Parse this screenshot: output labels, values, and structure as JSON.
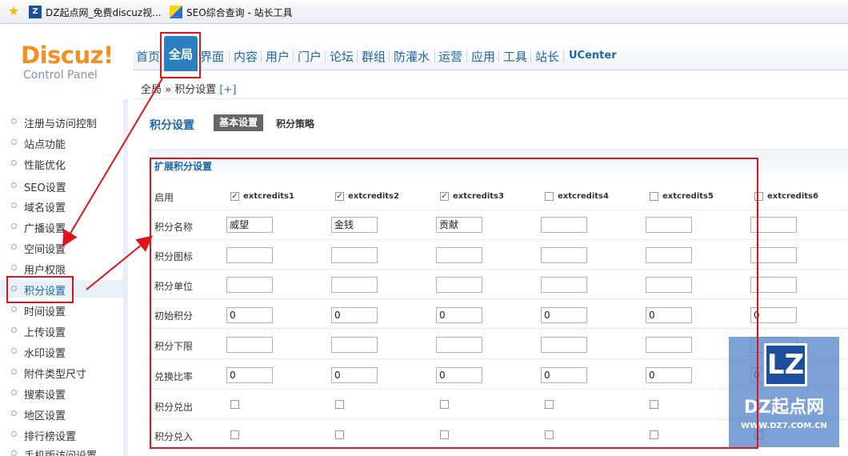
{
  "bookmarks": [
    {
      "label": "DZ起点网_免费discuz视..."
    },
    {
      "label": "SEO综合查询 - 站长工具"
    }
  ],
  "logo": {
    "main": "Discuz!",
    "sub": "Control Panel"
  },
  "nav": {
    "active": "全局",
    "items": [
      "首页",
      "界面",
      "内容",
      "用户",
      "门户",
      "论坛",
      "群组",
      "防灌水",
      "运营",
      "应用",
      "工具",
      "站长",
      "UCenter"
    ]
  },
  "breadcrumb": {
    "path": "全局 » 积分设置",
    "plus": "[+]"
  },
  "sidebar": {
    "items": [
      "注册与访问控制",
      "站点功能",
      "性能优化",
      "SEO设置",
      "域名设置",
      "广播设置",
      "空间设置",
      "用户权限",
      "积分设置",
      "时间设置",
      "上传设置",
      "水印设置",
      "附件类型尺寸",
      "搜索设置",
      "地区设置",
      "排行榜设置",
      "手机版访问设置"
    ],
    "active": "积分设置"
  },
  "page": {
    "title": "积分设置",
    "tab_basic": "基本设置",
    "tab_policy": "积分策略"
  },
  "section": {
    "title": "扩展积分设置"
  },
  "table": {
    "columns": [
      {
        "name": "extcredits1",
        "enabled": true,
        "title": "威望",
        "initial": "0",
        "ratio": "0"
      },
      {
        "name": "extcredits2",
        "enabled": true,
        "title": "金钱",
        "initial": "0",
        "ratio": "0"
      },
      {
        "name": "extcredits3",
        "enabled": true,
        "title": "贡献",
        "initial": "0",
        "ratio": "0"
      },
      {
        "name": "extcredits4",
        "enabled": false,
        "title": "",
        "initial": "0",
        "ratio": "0"
      },
      {
        "name": "extcredits5",
        "enabled": false,
        "title": "",
        "initial": "0",
        "ratio": "0"
      },
      {
        "name": "extcredits6",
        "enabled": false,
        "title": "",
        "initial": "0",
        "ratio": "0"
      }
    ],
    "row_labels": {
      "enable": "启用",
      "name": "积分名称",
      "icon": "积分图标",
      "unit": "积分单位",
      "initial": "初始积分",
      "lower": "积分下限",
      "ratio": "兑换比率",
      "out": "积分兑出",
      "in": "积分兑入"
    }
  },
  "watermark": {
    "logo": "LZ",
    "text": "DZ起点网",
    "url": "WWW.DZ7.COM.CN"
  },
  "colors": {
    "accent": "#1f66a8",
    "nav_active": "#2a7fc1",
    "annotation": "#e0121c",
    "logo": "#f58f1f"
  }
}
